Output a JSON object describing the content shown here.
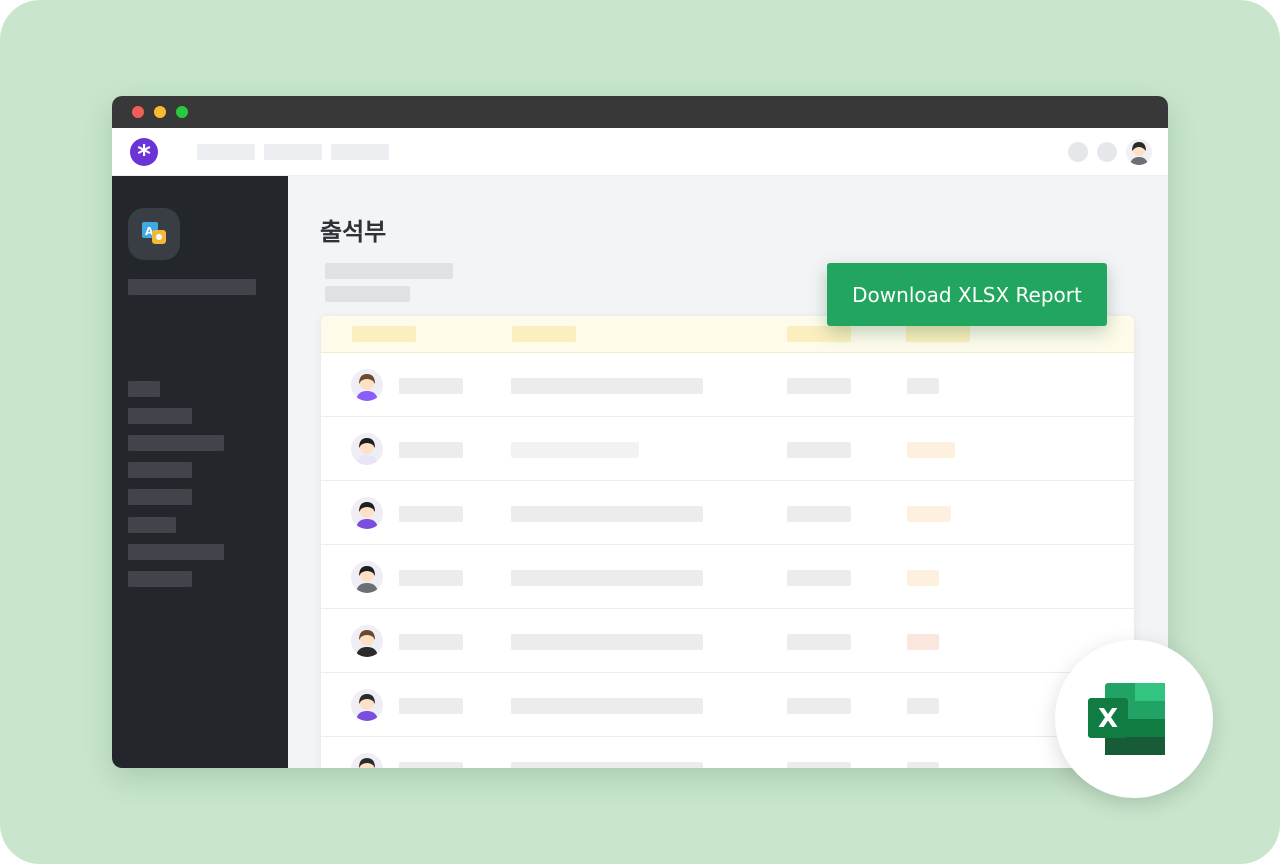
{
  "page": {
    "title": "출석부"
  },
  "actions": {
    "download_label": "Download XLSX Report"
  },
  "icons": {
    "logo": "asterisk-icon",
    "export_badge": "excel-icon",
    "app": "translate-app-icon"
  },
  "colors": {
    "background": "#c8e6cc",
    "brand_purple": "#6a35d6",
    "download_green": "#22a65f",
    "sidebar": "#23262b",
    "excel_green": "#107c41"
  },
  "table": {
    "rows": [
      {
        "avatar": "person-avatar",
        "status_color": "#ebecee"
      },
      {
        "avatar": "person-avatar",
        "status_color": "#fdf0dd"
      },
      {
        "avatar": "person-avatar",
        "status_color": "#fdf0dd"
      },
      {
        "avatar": "person-avatar",
        "status_color": "#fdf0dd"
      },
      {
        "avatar": "person-avatar",
        "status_color": "#fbe6dd"
      },
      {
        "avatar": "person-avatar",
        "status_color": "#ebecee"
      },
      {
        "avatar": "person-avatar",
        "status_color": "#ebecee"
      }
    ]
  }
}
